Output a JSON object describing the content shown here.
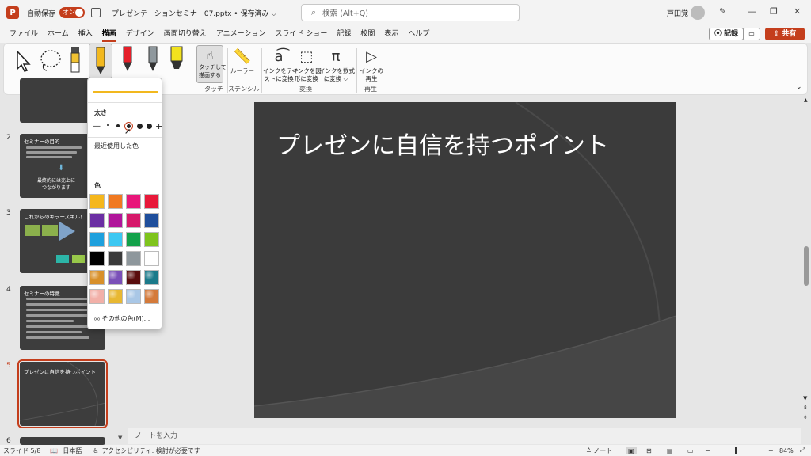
{
  "title_bar": {
    "autosave_label": "自動保存",
    "toggle_label": "オン",
    "document_title": "プレゼンテーションセミナー07.pptx • 保存済み ⌵",
    "search_placeholder": "検索 (Alt+Q)",
    "user_name": "戸田覚"
  },
  "menu": {
    "tabs": [
      "ファイル",
      "ホーム",
      "挿入",
      "描画",
      "デザイン",
      "画面切り替え",
      "アニメーション",
      "スライド ショー",
      "記録",
      "校閲",
      "表示",
      "ヘルプ"
    ],
    "active_tab": "描画",
    "record_label": "記録",
    "share_label": "共有"
  },
  "ribbon": {
    "touch_button": "タッチして\n描画する",
    "ruler_button": "ルーラー",
    "ink_to_text": "インクをテキ\nストに変換",
    "ink_to_shape": "インクを図\n形に変換",
    "ink_to_math": "インクを数式\nに変換 ⌵",
    "ink_replay": "インクの\n再生",
    "groups": {
      "touch": "タッチ",
      "stencil": "ステンシル",
      "convert": "変換",
      "replay": "再生"
    }
  },
  "pen_dropdown": {
    "thickness_label": "太さ",
    "recent_label": "最近使用した色",
    "colors_label": "色",
    "more_colors": "その他の色(M)...",
    "swatches": [
      [
        "#f5b71c",
        "#f07921",
        "#e8167a",
        "#e8193a"
      ],
      [
        "#6b2fa3",
        "#b0159a",
        "#d6196a",
        "#1f4f9c"
      ],
      [
        "#1ea0dd",
        "#3cc8f2",
        "#13a14a",
        "#7fc41d"
      ],
      [
        "#000000",
        "#3a3a3a",
        "#8e979c",
        "#ffffff"
      ],
      [
        "#d8902a",
        "#7a4fb8",
        "#5a0d0d",
        "#1b7a8a"
      ],
      [
        "#f2b0a8",
        "#e8b832",
        "#a9c7e6",
        "#d47a3a"
      ]
    ]
  },
  "slides": [
    {
      "number": "2",
      "title": "セミナーの目的",
      "caption": "最終的には売上に\nつながります"
    },
    {
      "number": "3",
      "title": "これからのキラースキル！"
    },
    {
      "number": "4",
      "title": "セミナーの特徴"
    },
    {
      "number": "5",
      "title": "プレゼンに自信を持つポイント"
    },
    {
      "number": "6",
      "title": ""
    }
  ],
  "main_slide": {
    "title": "プレゼンに自信を持つポイント"
  },
  "notes_placeholder": "ノートを入力",
  "status": {
    "slide_counter": "スライド 5/8",
    "language": "日本語",
    "accessibility": "アクセシビリティ: 検討が必要です",
    "notes_btn": "ノート",
    "zoom": "84%"
  }
}
